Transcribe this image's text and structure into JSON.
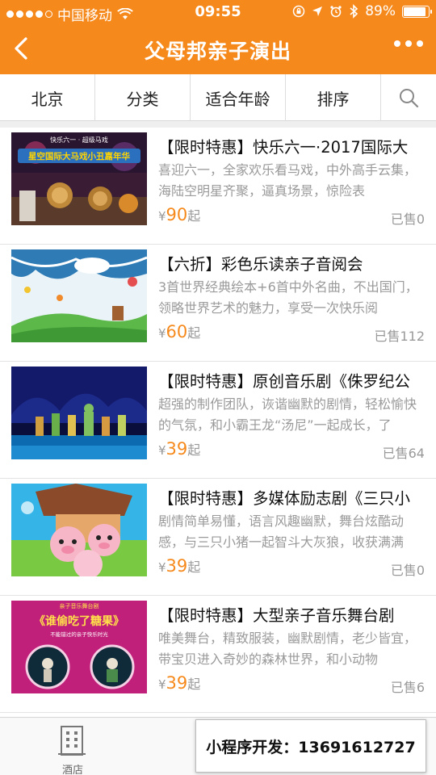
{
  "statusbar": {
    "carrier": "中国移动",
    "time": "09:55",
    "battery": "89%",
    "battery_level": 0.89
  },
  "header": {
    "title": "父母邦亲子演出"
  },
  "filters": {
    "city": "北京",
    "category": "分类",
    "age": "适合年龄",
    "sort": "排序"
  },
  "items": [
    {
      "title": "【限时特惠】快乐六一·2017国际大",
      "desc": "喜迎六一，全家欢乐看马戏，中外高手云集，海陆空明星齐聚，逼真场景，惊险表",
      "currency": "¥",
      "price": "90",
      "price_suffix": "起",
      "sold": "已售0",
      "thumb_text_1": "快乐六一 · 超级马戏",
      "thumb_text_2": "星空国际大马戏小丑嘉年华"
    },
    {
      "title": "【六折】彩色乐读亲子音阅会",
      "desc": "3首世界经典绘本+6首中外名曲，不出国门，领略世界艺术的魅力，享受一次快乐阅",
      "currency": "¥",
      "price": "60",
      "price_suffix": "起",
      "sold": "已售112"
    },
    {
      "title": "【限时特惠】原创音乐剧《侏罗纪公",
      "desc": "超强的制作团队，诙谐幽默的剧情，轻松愉快的气氛，和小霸王龙“汤尼”一起成长，了",
      "currency": "¥",
      "price": "39",
      "price_suffix": "起",
      "sold": "已售64"
    },
    {
      "title": "【限时特惠】多媒体励志剧《三只小",
      "desc": "剧情简单易懂，语言风趣幽默，舞台炫酷动感，与三只小猪一起智斗大灰狼，收获满满",
      "currency": "¥",
      "price": "39",
      "price_suffix": "起",
      "sold": "已售0"
    },
    {
      "title": "【限时特惠】大型亲子音乐舞台剧",
      "desc": "唯美舞台，精致服装，幽默剧情，老少皆宜，带宝贝进入奇妙的森林世界，和小动物",
      "currency": "¥",
      "price": "39",
      "price_suffix": "起",
      "sold": "已售6",
      "thumb_text_1": "亲子音乐舞台剧",
      "thumb_text_2": "《谁偷吃了糖果》",
      "thumb_text_3": "不能错过的亲子快乐时光"
    }
  ],
  "tabbar": {
    "hotel_label": "酒店"
  },
  "banner": {
    "text": "小程序开发：13691612727"
  }
}
